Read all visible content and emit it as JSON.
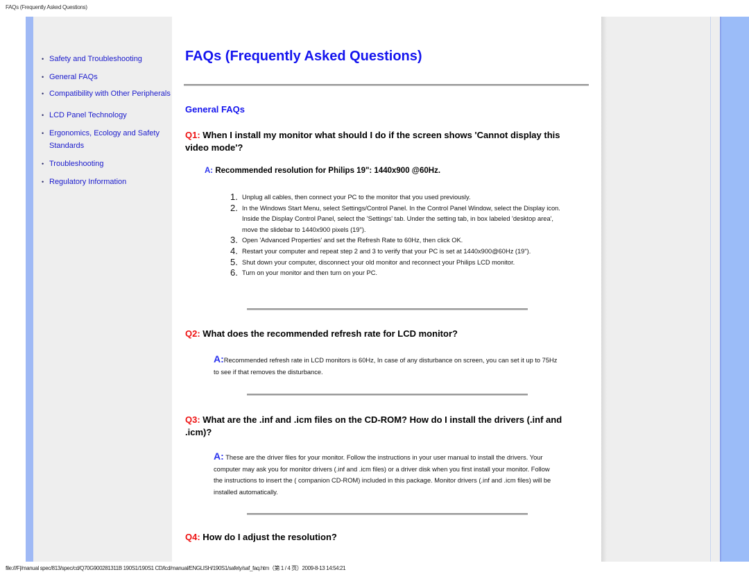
{
  "header": {
    "doc_title": "FAQs (Frequently Asked Questions)"
  },
  "sidebar": {
    "bullet": "•",
    "items": [
      {
        "label": "Safety and Troubleshooting"
      },
      {
        "label": "General FAQs"
      },
      {
        "label": "Compatibility with Other Peripherals"
      },
      {
        "label": "LCD Panel Technology"
      },
      {
        "label": "Ergonomics, Ecology and Safety"
      },
      {
        "label": "Standards"
      },
      {
        "label": "Troubleshooting"
      },
      {
        "label": "Regulatory Information"
      }
    ]
  },
  "main": {
    "title": "FAQs (Frequently Asked Questions)",
    "section": "General FAQs",
    "q1": {
      "label": "Q1:",
      "text": " When I install my monitor what should I do if the screen shows 'Cannot display this video mode'?",
      "answer_label": "A:",
      "answer_text": " Recommended resolution for Philips 19\": 1440x900 @60Hz.",
      "steps": [
        {
          "n": "1.",
          "text": "Unplug all cables, then connect your PC to the monitor that you used previously."
        },
        {
          "n": "2.",
          "text": "In the Windows Start Menu, select Settings/Control Panel. In the Control Panel Window, select the Display icon. Inside the Display Control Panel, select the 'Settings' tab. Under the setting tab, in box labeled 'desktop area', move the slidebar to 1440x900 pixels (19\")."
        },
        {
          "n": "3.",
          "text": "Open 'Advanced Properties' and set the Refresh Rate to 60Hz, then click OK."
        },
        {
          "n": "4.",
          "text": "Restart your computer and repeat step 2 and 3 to verify that your PC is set at 1440x900@60Hz (19\")."
        },
        {
          "n": "5.",
          "text": "Shut down your computer, disconnect your old monitor and reconnect your Philips LCD monitor."
        },
        {
          "n": "6.",
          "text": "Turn on your monitor and then turn on your PC."
        }
      ]
    },
    "q2": {
      "label": "Q2:",
      "text": " What does the recommended refresh rate for LCD monitor?",
      "answer_label": "A:",
      "answer_text": "Recommended refresh rate in LCD monitors is 60Hz, In case of any disturbance on screen, you can set it up to 75Hz to see if that removes the disturbance."
    },
    "q3": {
      "label": "Q3:",
      "text": " What are the .inf and .icm files on the CD-ROM? How do I install the drivers (.inf and .icm)?",
      "answer_label": "A:",
      "answer_text": " These are the driver files for your monitor. Follow the instructions in your user manual to install the drivers. Your computer may ask you for monitor drivers (.inf and .icm files) or a driver disk when you first install your monitor. Follow the instructions to insert the ( companion CD-ROM) included in this package. Monitor drivers (.inf and .icm files) will be installed automatically."
    },
    "q4": {
      "label": "Q4:",
      "text": " How do I adjust the resolution?"
    }
  },
  "footer": {
    "path": "file:///F|/manual spec/813/spec/cd/Q70G900281311B 190S1/190S1 CD/lcd/manual/ENGLISH/190S1/safety/saf_faq.htm（第 1 / 4 页）2009-8-13 14:54:21"
  },
  "colors": {
    "link": "#1a1acc",
    "heading": "#1414ee",
    "question_label": "#ee1111",
    "answer_label": "#2a33ee",
    "accent_strip": "#9bbcf8"
  }
}
